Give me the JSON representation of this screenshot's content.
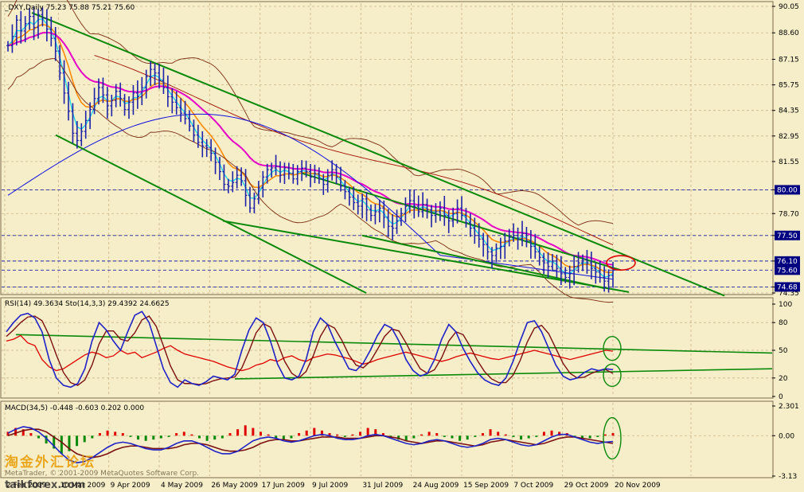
{
  "colors": {
    "background": "#F6EDC9",
    "grid": "#C9B586",
    "frame": "#7A6A4A",
    "price_bar": "#1E22A8",
    "ema_fast": "#1ED7E6",
    "ema_mid": "#FF8A00",
    "ema_magenta": "#E600C8",
    "ma_red": "#A11000",
    "ma_blue": "#1010E0",
    "bollinger": "#7A2A10",
    "channel": "#0A8A0A",
    "rsi": "#E00000",
    "stoch_main": "#1E22C8",
    "stoch_signal": "#7A1010",
    "macd_pos": "#E00000",
    "macd_neg": "#0A8A0A",
    "circle_red": "#E00000",
    "circle_green": "#0A8A0A",
    "current_price_box": "#000080",
    "watermark": "#E89A00"
  },
  "header": {
    "main": "_DXY,Daily   75.23 75.88 75.21 75.60",
    "rsi": "RSI(14) 49.3634  Sto(14,3,3) 29.4392 24.6625",
    "macd": "MACD(34,5) -0.448 -0.603 0.202 0.000"
  },
  "watermark": {
    "chinese": "淘金外汇论坛",
    "copyright": "MetaTrader, © 2001-2009 MetaQuotes Software Corp.",
    "site": "taikforex.com"
  },
  "chart_data": {
    "type": "candlestick",
    "title": "_DXY,Daily",
    "ohlc_last": {
      "open": 75.23,
      "high": 75.88,
      "low": 75.21,
      "close": 75.6
    },
    "x_tick_labels": [
      "2 Feb 2009",
      "10 Mar 2009",
      "9 Apr 2009",
      "4 May 2009",
      "26 May 2009",
      "17 Jun 2009",
      "9 Jul 2009",
      "31 Jul 2009",
      "24 Aug 2009",
      "15 Sep 2009",
      "7 Oct 2009",
      "29 Oct 2009",
      "20 Nov 2009"
    ],
    "price_panel": {
      "ylim": [
        74.35,
        90.05
      ],
      "y_tick_labels": [
        90.05,
        88.6,
        87.15,
        85.75,
        84.35,
        82.95,
        81.55,
        80.0,
        78.7,
        77.5,
        76.1,
        74.68,
        74.35
      ],
      "highlighted_levels": [
        {
          "label": "80.00",
          "value": 80.0
        },
        {
          "label": "77.50",
          "value": 77.5
        },
        {
          "label": "76.10",
          "value": 76.1
        },
        {
          "label": "75.60",
          "value": 75.6
        },
        {
          "label": "74.68",
          "value": 74.68
        }
      ],
      "closes": [
        87.9,
        88.4,
        89.3,
        88.7,
        89.1,
        89.5,
        88.9,
        89.6,
        89.4,
        88.8,
        88.3,
        87.6,
        86.4,
        85.3,
        84.3,
        83.1,
        82.7,
        83.2,
        83.8,
        84.4,
        85.0,
        85.6,
        85.2,
        84.6,
        84.9,
        85.4,
        85.0,
        84.4,
        84.8,
        85.3,
        85.1,
        85.6,
        86.2,
        86.6,
        86.4,
        86.0,
        85.6,
        85.1,
        84.8,
        84.5,
        84.2,
        83.9,
        83.5,
        83.0,
        82.6,
        82.4,
        82.3,
        82.0,
        81.5,
        81.0,
        80.3,
        80.2,
        80.4,
        80.8,
        80.5,
        79.7,
        79.0,
        79.5,
        80.1,
        80.7,
        81.1,
        81.2,
        81.3,
        80.8,
        81.2,
        80.9,
        80.6,
        81.0,
        81.2,
        81.0,
        80.7,
        80.9,
        80.6,
        80.3,
        80.8,
        81.1,
        80.7,
        80.2,
        79.9,
        79.6,
        79.3,
        79.1,
        79.5,
        78.9,
        78.6,
        78.8,
        79.0,
        78.5,
        78.0,
        77.9,
        78.3,
        78.7,
        79.1,
        79.4,
        79.1,
        78.8,
        79.2,
        78.9,
        78.6,
        78.8,
        79.0,
        78.6,
        78.3,
        78.7,
        79.0,
        78.6,
        78.2,
        77.9,
        77.5,
        77.3,
        77.0,
        76.6,
        76.4,
        76.8,
        76.9,
        77.2,
        77.4,
        77.5,
        77.3,
        77.6,
        77.2,
        76.9,
        76.6,
        76.3,
        76.0,
        75.8,
        76.1,
        75.7,
        75.4,
        75.2,
        75.4,
        75.8,
        76.0,
        76.2,
        76.0,
        75.7,
        75.5,
        75.2,
        75.0,
        75.3,
        75.6
      ]
    },
    "rsi_panel": {
      "ylim": [
        0,
        100
      ],
      "y_tick_labels": [
        100,
        80,
        50,
        20,
        0
      ],
      "rsi_values": [
        60,
        62,
        66,
        58,
        55,
        40,
        32,
        28,
        30,
        35,
        40,
        45,
        48,
        46,
        42,
        44,
        50,
        46,
        48,
        42,
        45,
        48,
        52,
        55,
        50,
        46,
        44,
        42,
        40,
        38,
        35,
        32,
        30,
        28,
        30,
        34,
        36,
        40,
        38,
        42,
        44,
        40,
        38,
        42,
        44,
        46,
        45,
        43,
        41,
        38,
        35,
        37,
        40,
        42,
        44,
        46,
        48,
        46,
        44,
        42,
        40,
        38,
        40,
        43,
        45,
        47,
        45,
        43,
        41,
        40,
        42,
        44,
        46,
        48,
        50,
        48,
        46,
        44,
        42,
        40,
        42,
        44,
        46,
        48,
        50,
        49
      ],
      "stoch_main": [
        70,
        80,
        88,
        90,
        85,
        70,
        40,
        20,
        12,
        10,
        14,
        30,
        60,
        80,
        72,
        60,
        50,
        70,
        88,
        92,
        80,
        55,
        30,
        15,
        10,
        18,
        14,
        12,
        16,
        22,
        20,
        18,
        24,
        50,
        72,
        85,
        80,
        60,
        35,
        20,
        18,
        22,
        40,
        70,
        85,
        78,
        60,
        45,
        30,
        28,
        36,
        50,
        66,
        78,
        74,
        60,
        40,
        28,
        22,
        25,
        40,
        62,
        78,
        70,
        52,
        38,
        26,
        18,
        14,
        12,
        20,
        38,
        60,
        80,
        82,
        70,
        52,
        34,
        22,
        18,
        20,
        26,
        30,
        28,
        30,
        29
      ],
      "stoch_signal": [
        65,
        72,
        80,
        86,
        87,
        82,
        66,
        45,
        26,
        15,
        12,
        18,
        34,
        57,
        71,
        71,
        62,
        60,
        69,
        83,
        87,
        76,
        55,
        33,
        18,
        14,
        14,
        13,
        14,
        17,
        19,
        20,
        21,
        31,
        49,
        69,
        79,
        75,
        58,
        38,
        25,
        20,
        27,
        44,
        65,
        78,
        74,
        61,
        45,
        34,
        31,
        38,
        51,
        65,
        73,
        71,
        58,
        43,
        30,
        25,
        29,
        42,
        60,
        70,
        67,
        54,
        39,
        27,
        19,
        15,
        15,
        23,
        39,
        59,
        74,
        77,
        68,
        52,
        36,
        25,
        20,
        21,
        25,
        28,
        29,
        25
      ]
    },
    "macd_panel": {
      "ylim": [
        -3.13,
        2.301
      ],
      "y_tick_labels": [
        2.301,
        0.0,
        -3.13
      ],
      "histogram": [
        0.3,
        0.6,
        0.5,
        0.2,
        -0.2,
        -0.6,
        -1.0,
        -1.4,
        -1.2,
        -0.8,
        -0.5,
        -0.2,
        0.2,
        0.4,
        0.3,
        0.2,
        -0.1,
        -0.3,
        -0.4,
        -0.3,
        -0.2,
        -0.1,
        0.2,
        0.3,
        0.1,
        -0.2,
        -0.4,
        -0.3,
        -0.2,
        0.2,
        0.5,
        0.8,
        0.6,
        0.3,
        0.1,
        -0.2,
        -0.3,
        -0.2,
        0.2,
        0.4,
        0.6,
        0.4,
        0.2,
        0.1,
        -0.1,
        0.1,
        0.3,
        0.6,
        0.5,
        0.2,
        -0.1,
        -0.3,
        -0.4,
        -0.2,
        0.1,
        0.3,
        0.2,
        -0.1,
        -0.2,
        -0.4,
        -0.3,
        -0.1,
        0.2,
        0.5,
        0.3,
        0.1,
        -0.1,
        -0.3,
        -0.2,
        -0.1,
        0.3,
        0.4,
        0.3,
        0.2,
        -0.1,
        -0.3,
        -0.2,
        -0.1,
        0.1,
        0.2
      ],
      "macd_line": [
        0.2,
        0.5,
        0.7,
        0.6,
        0.3,
        -0.2,
        -0.8,
        -1.4,
        -1.9,
        -2.1,
        -2.0,
        -1.7,
        -1.3,
        -0.9,
        -0.6,
        -0.5,
        -0.6,
        -0.8,
        -1.0,
        -1.1,
        -1.1,
        -0.9,
        -0.6,
        -0.4,
        -0.4,
        -0.6,
        -0.9,
        -1.2,
        -1.4,
        -1.4,
        -1.2,
        -0.8,
        -0.4,
        -0.2,
        -0.1,
        -0.2,
        -0.4,
        -0.5,
        -0.4,
        -0.2,
        0.0,
        0.1,
        0.0,
        -0.2,
        -0.3,
        -0.3,
        -0.2,
        0.0,
        0.1,
        0.0,
        -0.2,
        -0.4,
        -0.6,
        -0.7,
        -0.6,
        -0.4,
        -0.3,
        -0.4,
        -0.6,
        -0.8,
        -0.9,
        -0.8,
        -0.6,
        -0.3,
        -0.2,
        -0.3,
        -0.5,
        -0.7,
        -0.8,
        -0.7,
        -0.4,
        -0.1,
        0.1,
        0.1,
        -0.1,
        -0.3,
        -0.5,
        -0.6,
        -0.5,
        -0.45
      ],
      "signal_line": [
        0.0,
        0.2,
        0.4,
        0.5,
        0.5,
        0.3,
        -0.1,
        -0.5,
        -1.0,
        -1.4,
        -1.6,
        -1.7,
        -1.6,
        -1.4,
        -1.1,
        -0.9,
        -0.8,
        -0.8,
        -0.9,
        -1.0,
        -1.0,
        -1.0,
        -0.9,
        -0.7,
        -0.6,
        -0.6,
        -0.7,
        -0.9,
        -1.1,
        -1.2,
        -1.2,
        -1.1,
        -0.9,
        -0.6,
        -0.4,
        -0.3,
        -0.3,
        -0.4,
        -0.4,
        -0.3,
        -0.2,
        -0.1,
        -0.1,
        -0.1,
        -0.2,
        -0.2,
        -0.2,
        -0.1,
        0.0,
        0.0,
        -0.1,
        -0.2,
        -0.4,
        -0.5,
        -0.6,
        -0.5,
        -0.4,
        -0.4,
        -0.5,
        -0.6,
        -0.7,
        -0.8,
        -0.7,
        -0.5,
        -0.4,
        -0.3,
        -0.4,
        -0.5,
        -0.6,
        -0.7,
        -0.6,
        -0.4,
        -0.2,
        -0.1,
        -0.1,
        -0.2,
        -0.3,
        -0.4,
        -0.5,
        -0.6
      ]
    }
  }
}
